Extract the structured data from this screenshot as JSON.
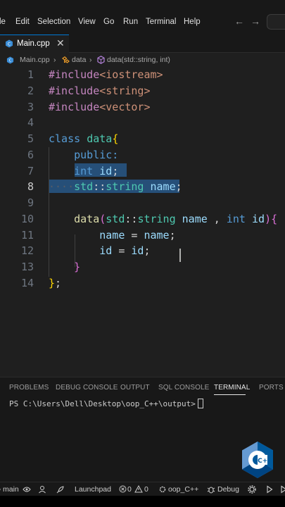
{
  "menubar": {
    "items": [
      "le",
      "Edit",
      "Selection",
      "View",
      "Go",
      "Run",
      "Terminal",
      "Help"
    ],
    "back_glyph": "←",
    "forward_glyph": "→"
  },
  "tab": {
    "label": "Main.cpp",
    "close_glyph": "✕"
  },
  "breadcrumb": {
    "file": "Main.cpp",
    "class": "data",
    "method": "data(std::string, int)",
    "separator": "›"
  },
  "editor": {
    "line_numbers": [
      "1",
      "2",
      "3",
      "4",
      "5",
      "6",
      "7",
      "8",
      "9",
      "10",
      "11",
      "12",
      "13",
      "14"
    ],
    "active_line": "8",
    "code": {
      "l1": {
        "a": "#include",
        "b": "<iostream>"
      },
      "l2": {
        "a": "#include",
        "b": "<string>"
      },
      "l3": {
        "a": "#include",
        "b": "<vector>"
      },
      "l5": {
        "a": "class",
        "b": " ",
        "c": "data",
        "d": "{"
      },
      "l6": {
        "a": "    ",
        "b": "public:"
      },
      "l7": {
        "a": "    ",
        "b": "int",
        "c": " ",
        "d": "id",
        "e": ";"
      },
      "l8": {
        "a": "····",
        "b": "std",
        "c": "::",
        "d": "string",
        "e": " ",
        "f": "name",
        "g": ";"
      },
      "l10": {
        "a": "    ",
        "b": "data",
        "c": "(",
        "d": "std",
        "e": "::",
        "f": "string",
        "g": " ",
        "h": "name",
        "i": " , ",
        "j": "int",
        "k": " ",
        "l": "id",
        "m": ")",
        "n": "{"
      },
      "l11": {
        "a": "        ",
        "b": "name",
        "c": " = ",
        "d": "name",
        "e": ";"
      },
      "l12": {
        "a": "        ",
        "b": "id",
        "c": " = ",
        "d": "id",
        "e": ";"
      },
      "l13": {
        "a": "    ",
        "b": "}"
      },
      "l14": {
        "a": "}",
        "b": ";"
      }
    }
  },
  "panel": {
    "tabs": [
      "PROBLEMS",
      "DEBUG CONSOLE",
      "OUTPUT",
      "SQL CONSOLE",
      "TERMINAL",
      "PORTS"
    ],
    "active_tab": "TERMINAL",
    "terminal_prompt": "PS C:\\Users\\Dell\\Desktop\\oop_C++\\output>"
  },
  "statusbar": {
    "branch": "main",
    "launchpad": "Launchpad",
    "errors": "0",
    "warnings": "0",
    "folder": "oop_C++",
    "debug": "Debug"
  },
  "logo": {
    "text": "C++"
  },
  "colors": {
    "accent": "#0078d4",
    "selection": "#264f78",
    "editor_bg": "#1f1f1f",
    "chrome_bg": "#181818"
  },
  "icons": {
    "file_icon": "cpp-file-icon",
    "class_icon": "class-icon",
    "method_icon": "method-icon",
    "branch_icon": "source-control-icon",
    "sync_icon": "sync-icon",
    "launchpad_icon": "rocket-icon",
    "error_icon": "error-circle-icon",
    "warning_icon": "warning-triangle-icon",
    "debug_icon": "bug-icon",
    "run_icon": "play-icon",
    "settings_icon": "gear-icon"
  }
}
